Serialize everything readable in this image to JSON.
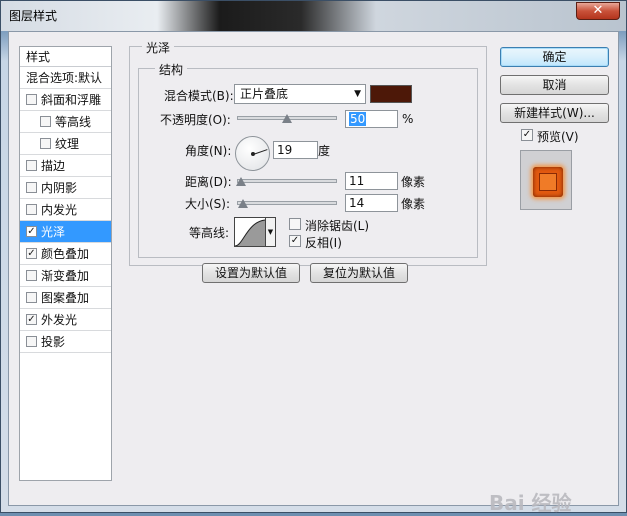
{
  "window": {
    "title": "图层样式",
    "close_symbol": "✕"
  },
  "styles_list": {
    "header": "样式",
    "blend_options": "混合选项:默认",
    "items": [
      {
        "label": "斜面和浮雕",
        "checked": false,
        "sub": false
      },
      {
        "label": "等高线",
        "checked": false,
        "sub": true
      },
      {
        "label": "纹理",
        "checked": false,
        "sub": true
      },
      {
        "label": "描边",
        "checked": false,
        "sub": false
      },
      {
        "label": "内阴影",
        "checked": false,
        "sub": false
      },
      {
        "label": "内发光",
        "checked": false,
        "sub": false
      },
      {
        "label": "光泽",
        "checked": true,
        "sub": false,
        "selected": true
      },
      {
        "label": "颜色叠加",
        "checked": true,
        "sub": false
      },
      {
        "label": "渐变叠加",
        "checked": false,
        "sub": false
      },
      {
        "label": "图案叠加",
        "checked": false,
        "sub": false
      },
      {
        "label": "外发光",
        "checked": true,
        "sub": false
      },
      {
        "label": "投影",
        "checked": false,
        "sub": false
      }
    ]
  },
  "satin": {
    "group_title": "光泽",
    "structure_title": "结构",
    "blend_mode_label": "混合模式(B):",
    "blend_mode_value": "正片叠底",
    "blend_color": "#4d1808",
    "opacity_label": "不透明度(O):",
    "opacity_value": "50",
    "opacity_unit": "%",
    "angle_label": "角度(N):",
    "angle_value": "19",
    "angle_unit": "度",
    "distance_label": "距离(D):",
    "distance_value": "11",
    "distance_unit": "像素",
    "size_label": "大小(S):",
    "size_value": "14",
    "size_unit": "像素",
    "contour_label": "等高线:",
    "anti_alias_label": "消除锯齿(L)",
    "anti_alias_checked": false,
    "invert_label": "反相(I)",
    "invert_checked": true,
    "set_default_label": "设置为默认值",
    "reset_default_label": "复位为默认值"
  },
  "right_panel": {
    "ok_label": "确定",
    "cancel_label": "取消",
    "new_style_label": "新建样式(W)...",
    "preview_label": "预览(V)",
    "preview_checked": true
  },
  "watermark": "Bai 经验"
}
